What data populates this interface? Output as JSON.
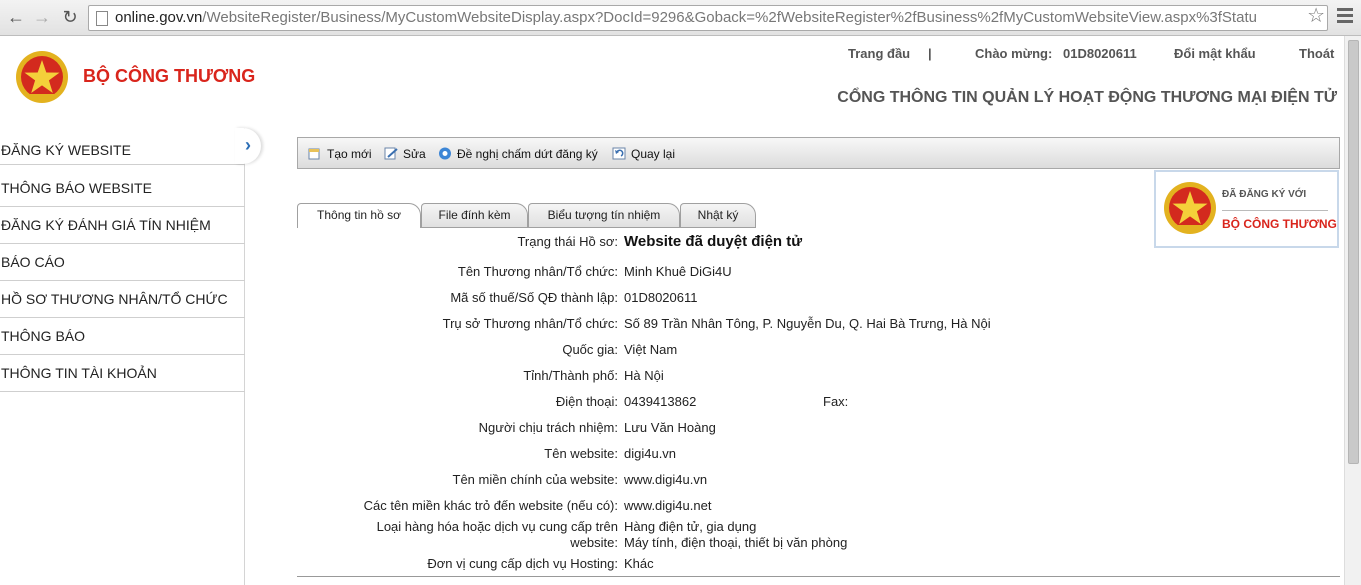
{
  "browser": {
    "url_host": "online.gov.vn",
    "url_path": "/WebsiteRegister/Business/MyCustomWebsiteDisplay.aspx?DocId=9296&Goback=%2fWebsiteRegister%2fBusiness%2fMyCustomWebsiteView.aspx%3fStatu"
  },
  "header": {
    "site_name": "BỘ CÔNG THƯƠNG",
    "home_link": "Trang đầu",
    "separator": "|",
    "welcome_label": "Chào mừng:",
    "username": "01D8020611",
    "change_password": "Đổi mật khẩu",
    "logout": "Thoát",
    "portal_title": "CỔNG THÔNG TIN QUẢN LÝ HOẠT ĐỘNG THƯƠNG MẠI ĐIỆN TỬ"
  },
  "sidebar": {
    "toggle_glyph": "›",
    "items": [
      {
        "label": "ĐĂNG KÝ WEBSITE"
      },
      {
        "label": "THÔNG BÁO WEBSITE"
      },
      {
        "label": "ĐĂNG KÝ ĐÁNH GIÁ TÍN NHIỆM"
      },
      {
        "label": "BÁO CÁO"
      },
      {
        "label": "HỒ SƠ THƯƠNG NHÂN/TỔ CHỨC"
      },
      {
        "label": "THÔNG BÁO"
      },
      {
        "label": "THÔNG TIN TÀI KHOẢN"
      }
    ]
  },
  "toolbar": {
    "create": "Tạo mới",
    "edit": "Sửa",
    "terminate": "Đề nghị chấm dứt đăng ký",
    "back": "Quay lại"
  },
  "badge": {
    "line1": "ĐÃ ĐĂNG KÝ VỚI",
    "line2": "BỘ CÔNG THƯƠNG"
  },
  "tabs": [
    {
      "label": "Thông tin hồ sơ",
      "active": true
    },
    {
      "label": "File đính kèm",
      "active": false
    },
    {
      "label": "Biểu tượng tín nhiệm",
      "active": false
    },
    {
      "label": "Nhật ký",
      "active": false
    }
  ],
  "form": {
    "status": {
      "label": "Trạng thái Hồ sơ:",
      "value": "Website đã duyệt điện tử"
    },
    "merchant_name": {
      "label": "Tên Thương nhân/Tổ chức:",
      "value": "Minh Khuê DiGi4U"
    },
    "tax_code": {
      "label": "Mã số thuế/Số QĐ thành lập:",
      "value": "01D8020611"
    },
    "address": {
      "label": "Trụ sở Thương nhân/Tổ chức:",
      "value": "Số 89 Trần Nhân Tông, P. Nguyễn Du, Q. Hai Bà Trưng, Hà Nội"
    },
    "country": {
      "label": "Quốc gia:",
      "value": "Việt Nam"
    },
    "province": {
      "label": "Tỉnh/Thành phố:",
      "value": "Hà Nội"
    },
    "phone": {
      "label": "Điện thoại:",
      "value": "0439413862"
    },
    "fax": {
      "label": "Fax:",
      "value": ""
    },
    "responsible": {
      "label": "Người chịu trách nhiệm:",
      "value": "Lưu Văn Hoàng"
    },
    "website_name": {
      "label": "Tên website:",
      "value": "digi4u.vn"
    },
    "main_domain": {
      "label": "Tên miền chính của website:",
      "value": "www.digi4u.vn"
    },
    "other_domains": {
      "label": "Các tên miền khác trỏ đến website (nếu có):",
      "value": "www.digi4u.net"
    },
    "goods_type": {
      "label_line1": "Loại hàng hóa hoặc dịch vụ cung cấp trên",
      "label_line2": "website:",
      "value_line1": "Hàng điện tử, gia dụng",
      "value_line2": "Máy tính, điện thoại, thiết bị văn phòng"
    },
    "hosting": {
      "label": "Đơn vị cung cấp dịch vụ Hosting:",
      "value": "Khác"
    }
  }
}
